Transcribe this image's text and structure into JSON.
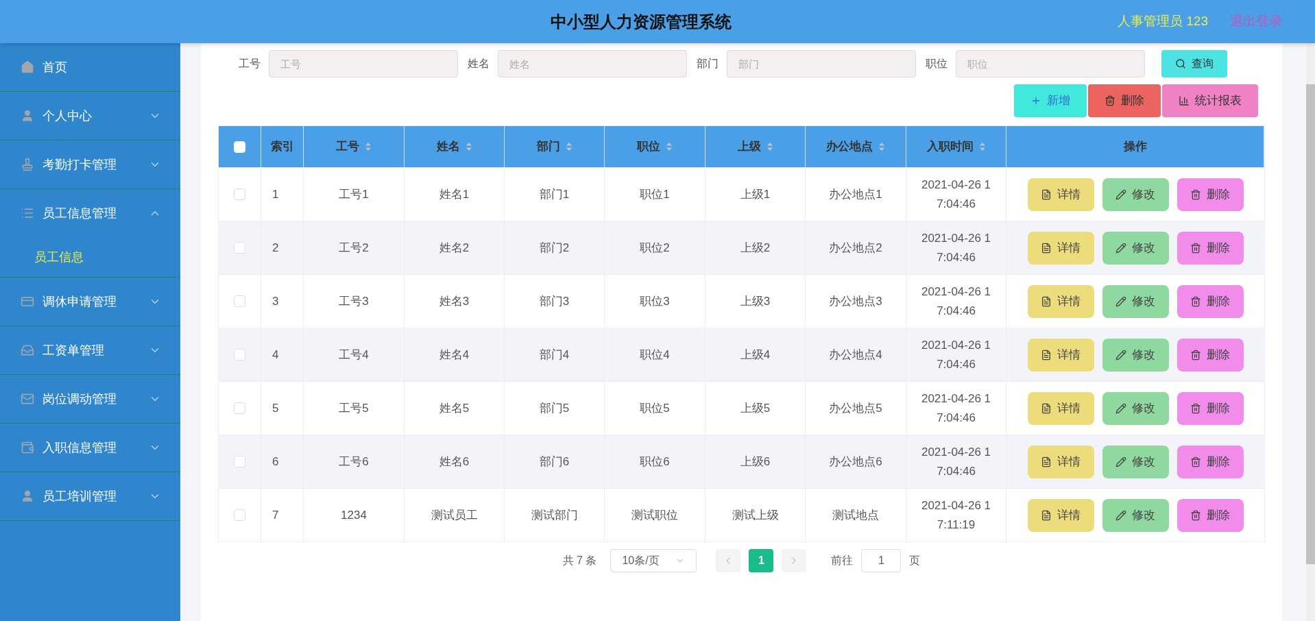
{
  "header": {
    "title": "中小型人力资源管理系统",
    "user": "人事管理员 123",
    "logout": "退出登录"
  },
  "sidebar": {
    "items": [
      {
        "label": "首页"
      },
      {
        "label": "个人中心",
        "expanded": false
      },
      {
        "label": "考勤打卡管理",
        "expanded": false
      },
      {
        "label": "员工信息管理",
        "expanded": true,
        "children": [
          {
            "label": "员工信息",
            "selected": true
          }
        ]
      },
      {
        "label": "调休申请管理",
        "expanded": false
      },
      {
        "label": "工资单管理",
        "expanded": false
      },
      {
        "label": "岗位调动管理",
        "expanded": false
      },
      {
        "label": "入职信息管理",
        "expanded": false
      },
      {
        "label": "员工培训管理",
        "expanded": false
      }
    ]
  },
  "search": {
    "fields": [
      {
        "label": "工号",
        "placeholder": "工号"
      },
      {
        "label": "姓名",
        "placeholder": "姓名"
      },
      {
        "label": "部门",
        "placeholder": "部门"
      },
      {
        "label": "职位",
        "placeholder": "职位"
      }
    ],
    "button": "查询"
  },
  "toolbar": [
    {
      "kind": "add",
      "label": "新增"
    },
    {
      "kind": "delete",
      "label": "删除"
    },
    {
      "kind": "report",
      "label": "统计报表"
    }
  ],
  "table": {
    "all_checked": false,
    "columns": [
      {
        "label": "索引",
        "sortable": false
      },
      {
        "label": "工号",
        "sortable": true
      },
      {
        "label": "姓名",
        "sortable": true
      },
      {
        "label": "部门",
        "sortable": true
      },
      {
        "label": "职位",
        "sortable": true
      },
      {
        "label": "上级",
        "sortable": true
      },
      {
        "label": "办公地点",
        "sortable": true
      },
      {
        "label": "入职时间",
        "sortable": true
      },
      {
        "label": "操作",
        "sortable": false
      }
    ],
    "rows": [
      {
        "checked": false,
        "cells": [
          "1",
          "工号1",
          "姓名1",
          "部门1",
          "职位1",
          "上级1",
          "办公地点1",
          "2021-04-26 17:04:46"
        ],
        "actions": [
          {
            "kind": "detail",
            "label": "详情"
          },
          {
            "kind": "edit",
            "label": "修改"
          },
          {
            "kind": "delete",
            "label": "删除"
          }
        ]
      },
      {
        "checked": false,
        "cells": [
          "2",
          "工号2",
          "姓名2",
          "部门2",
          "职位2",
          "上级2",
          "办公地点2",
          "2021-04-26 17:04:46"
        ],
        "actions": [
          {
            "kind": "detail",
            "label": "详情"
          },
          {
            "kind": "edit",
            "label": "修改"
          },
          {
            "kind": "delete",
            "label": "删除"
          }
        ]
      },
      {
        "checked": false,
        "cells": [
          "3",
          "工号3",
          "姓名3",
          "部门3",
          "职位3",
          "上级3",
          "办公地点3",
          "2021-04-26 17:04:46"
        ],
        "actions": [
          {
            "kind": "detail",
            "label": "详情"
          },
          {
            "kind": "edit",
            "label": "修改"
          },
          {
            "kind": "delete",
            "label": "删除"
          }
        ]
      },
      {
        "checked": false,
        "cells": [
          "4",
          "工号4",
          "姓名4",
          "部门4",
          "职位4",
          "上级4",
          "办公地点4",
          "2021-04-26 17:04:46"
        ],
        "actions": [
          {
            "kind": "detail",
            "label": "详情"
          },
          {
            "kind": "edit",
            "label": "修改"
          },
          {
            "kind": "delete",
            "label": "删除"
          }
        ]
      },
      {
        "checked": false,
        "cells": [
          "5",
          "工号5",
          "姓名5",
          "部门5",
          "职位5",
          "上级5",
          "办公地点5",
          "2021-04-26 17:04:46"
        ],
        "actions": [
          {
            "kind": "detail",
            "label": "详情"
          },
          {
            "kind": "edit",
            "label": "修改"
          },
          {
            "kind": "delete",
            "label": "删除"
          }
        ]
      },
      {
        "checked": false,
        "cells": [
          "6",
          "工号6",
          "姓名6",
          "部门6",
          "职位6",
          "上级6",
          "办公地点6",
          "2021-04-26 17:04:46"
        ],
        "actions": [
          {
            "kind": "detail",
            "label": "详情"
          },
          {
            "kind": "edit",
            "label": "修改"
          },
          {
            "kind": "delete",
            "label": "删除"
          }
        ]
      },
      {
        "checked": false,
        "cells": [
          "7",
          "1234",
          "测试员工",
          "测试部门",
          "测试职位",
          "测试上级",
          "测试地点",
          "2021-04-26 17:11:19"
        ],
        "actions": [
          {
            "kind": "detail",
            "label": "详情"
          },
          {
            "kind": "edit",
            "label": "修改"
          },
          {
            "kind": "delete",
            "label": "删除"
          }
        ]
      }
    ]
  },
  "pagination": {
    "total": "共 7 条",
    "page_size": "10条/页",
    "prev_disabled": true,
    "next_disabled": true,
    "pages": [
      {
        "label": "1",
        "selected": true
      }
    ],
    "goto_label": "前往",
    "goto_value": "1",
    "goto_suffix": "页"
  }
}
